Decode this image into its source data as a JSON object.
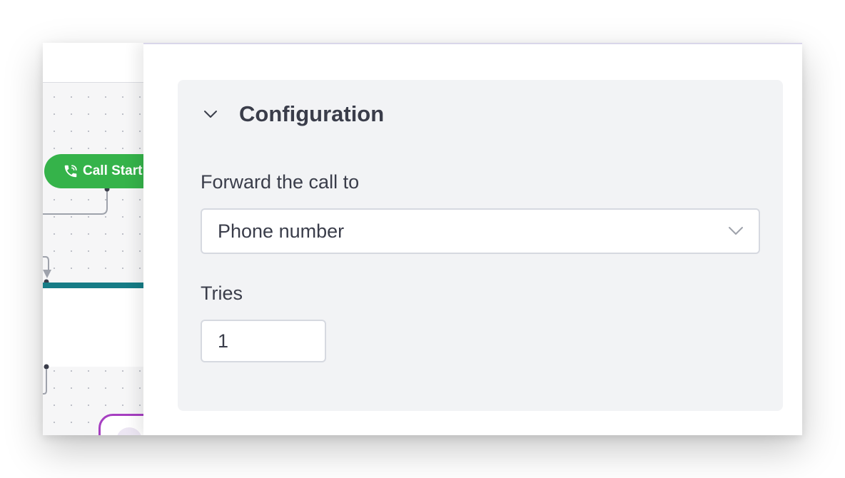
{
  "canvas": {
    "call_start_node": {
      "label": "Call Start",
      "icon": "phone-call-icon",
      "color": "#35b34a"
    },
    "teal_bar_color": "#167c86",
    "purple_node_color": "#a63fc1"
  },
  "configuration": {
    "title": "Configuration",
    "toggle_icon": "chevron-down-icon",
    "forward_label": "Forward the call to",
    "forward_value": "Phone number",
    "tries_label": "Tries",
    "tries_value": "1"
  }
}
